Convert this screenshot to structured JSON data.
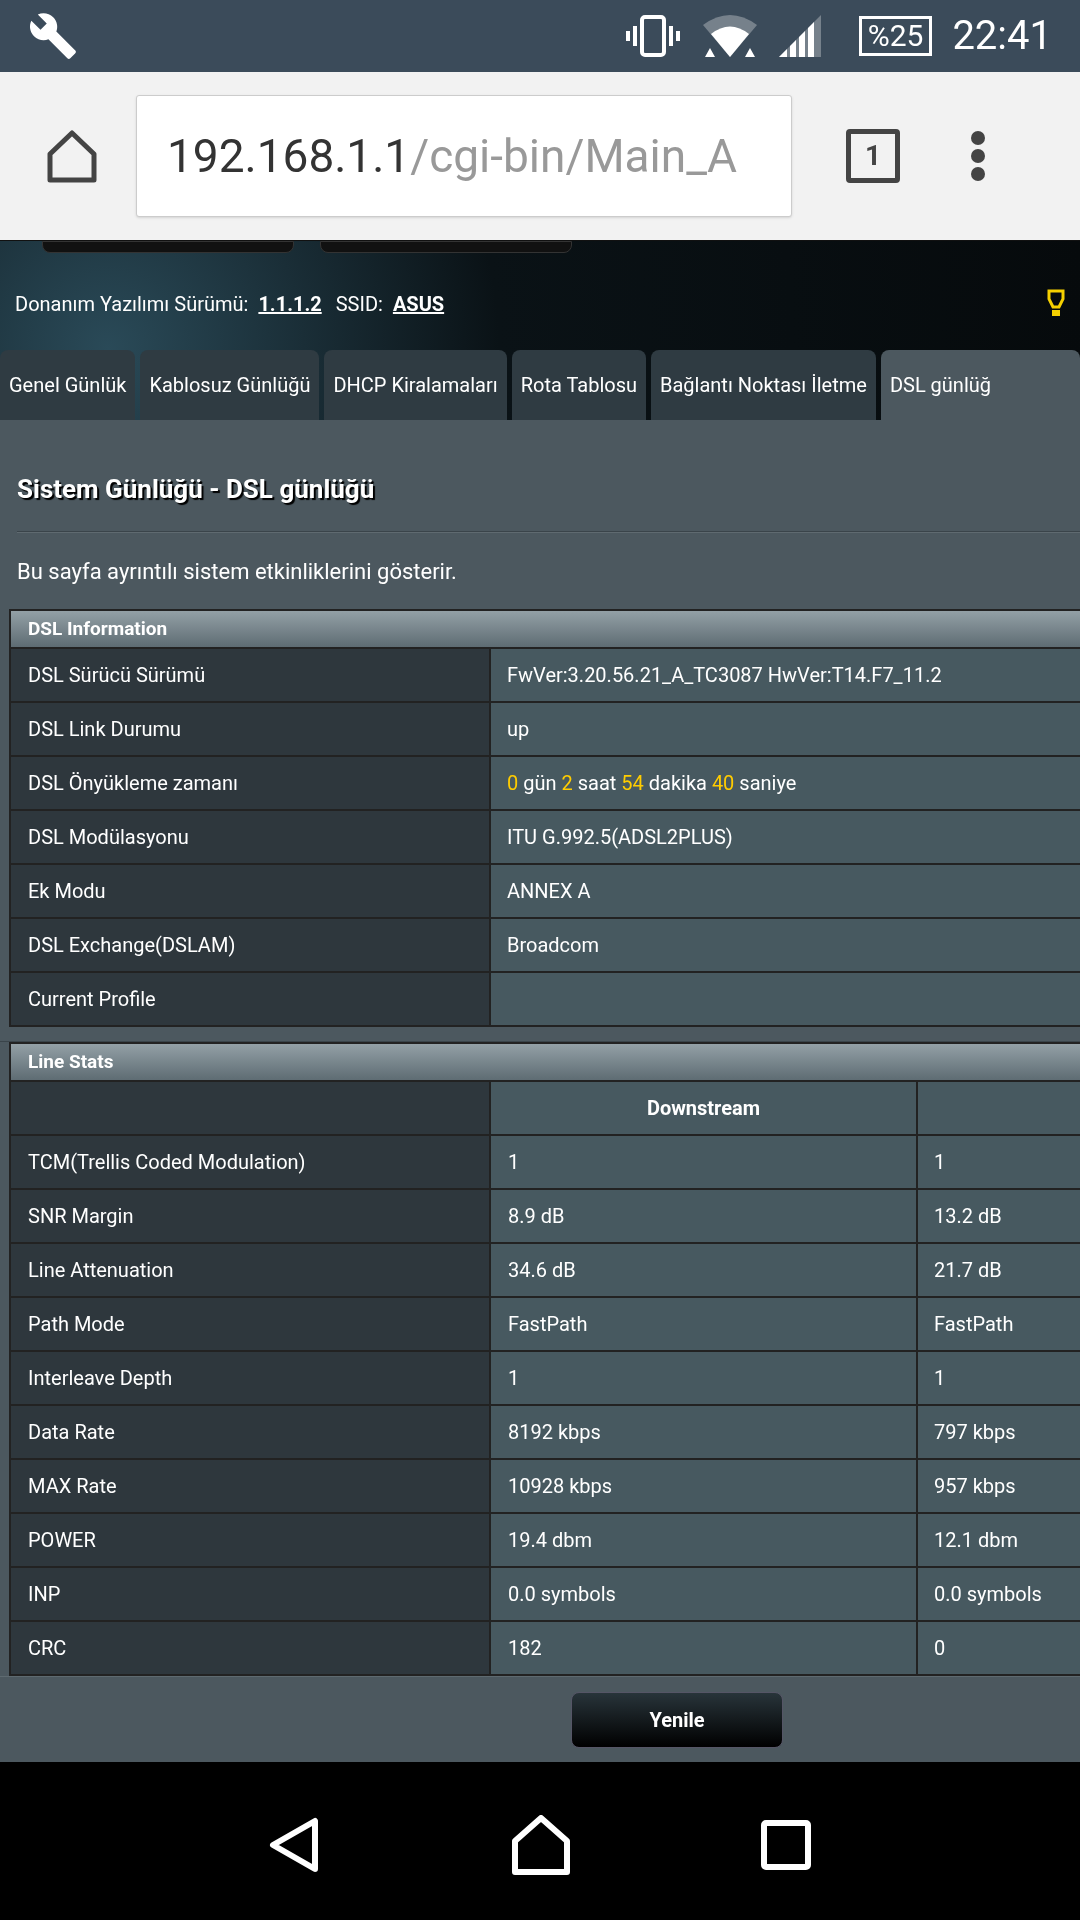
{
  "status_bar": {
    "battery": "%25",
    "time": "22:41"
  },
  "browser": {
    "url_host": "192.168.1.1",
    "url_path": "/cgi-bin/Main_A",
    "tab_count": "1"
  },
  "header": {
    "firmware_label": "Donanım Yazılımı Sürümü:",
    "firmware_value": "1.1.1.2",
    "ssid_label": "SSID:",
    "ssid_value": "ASUS"
  },
  "tabs": [
    {
      "label": "Genel Günlük",
      "selected": false
    },
    {
      "label": "Kablosuz Günlüğü",
      "selected": false
    },
    {
      "label": "DHCP Kiralamaları",
      "selected": false
    },
    {
      "label": "Rota Tablosu",
      "selected": false
    },
    {
      "label": "Bağlantı Noktası İletme",
      "selected": false
    },
    {
      "label": "DSL günlüğ",
      "selected": true
    }
  ],
  "page_title": "Sistem Günlüğü - DSL günlüğü",
  "description": "Bu sayfa ayrıntılı sistem etkinliklerini gösterir.",
  "dsl_information": {
    "title": "DSL Information",
    "rows": [
      {
        "label": "DSL Sürücü Sürümü",
        "value": [
          {
            "text": "FwVer:3.20.56.21_A_TC3087 HwVer:T14.F7_11.2",
            "highlight": false
          }
        ]
      },
      {
        "label": "DSL Link Durumu",
        "value": [
          {
            "text": "up",
            "highlight": false
          }
        ]
      },
      {
        "label": "DSL Önyükleme zamanı",
        "value": [
          {
            "text": "0",
            "highlight": true
          },
          {
            "text": " gün ",
            "highlight": false
          },
          {
            "text": "2",
            "highlight": true
          },
          {
            "text": " saat ",
            "highlight": false
          },
          {
            "text": "54",
            "highlight": true
          },
          {
            "text": " dakika ",
            "highlight": false
          },
          {
            "text": "40",
            "highlight": true
          },
          {
            "text": " saniye",
            "highlight": false
          }
        ]
      },
      {
        "label": "DSL Modülasyonu",
        "value": [
          {
            "text": "ITU G.992.5(ADSL2PLUS)",
            "highlight": false
          }
        ]
      },
      {
        "label": "Ek Modu",
        "value": [
          {
            "text": "ANNEX A",
            "highlight": false
          }
        ]
      },
      {
        "label": "DSL Exchange(DSLAM)",
        "value": [
          {
            "text": "Broadcom",
            "highlight": false
          }
        ]
      },
      {
        "label": "Current Profile",
        "value": []
      }
    ]
  },
  "line_stats": {
    "title": "Line Stats",
    "columns": [
      "Downstream"
    ],
    "rows": [
      {
        "label": "TCM(Trellis Coded Modulation)",
        "downstream": "1",
        "column_3": "1"
      },
      {
        "label": "SNR Margin",
        "downstream": "8.9 dB",
        "column_3": "13.2 dB"
      },
      {
        "label": "Line Attenuation",
        "downstream": "34.6 dB",
        "column_3": "21.7 dB"
      },
      {
        "label": "Path Mode",
        "downstream": "FastPath",
        "column_3": "FastPath"
      },
      {
        "label": "Interleave Depth",
        "downstream": "1",
        "column_3": "1"
      },
      {
        "label": "Data Rate",
        "downstream": "8192 kbps",
        "column_3": "797 kbps"
      },
      {
        "label": "MAX Rate",
        "downstream": "10928 kbps",
        "column_3": "957 kbps"
      },
      {
        "label": "POWER",
        "downstream": "19.4 dbm",
        "column_3": "12.1 dbm"
      },
      {
        "label": "INP",
        "downstream": "0.0 symbols",
        "column_3": "0.0 symbols"
      },
      {
        "label": "CRC",
        "downstream": "182",
        "column_3": "0"
      }
    ]
  },
  "refresh_button": "Yenile"
}
